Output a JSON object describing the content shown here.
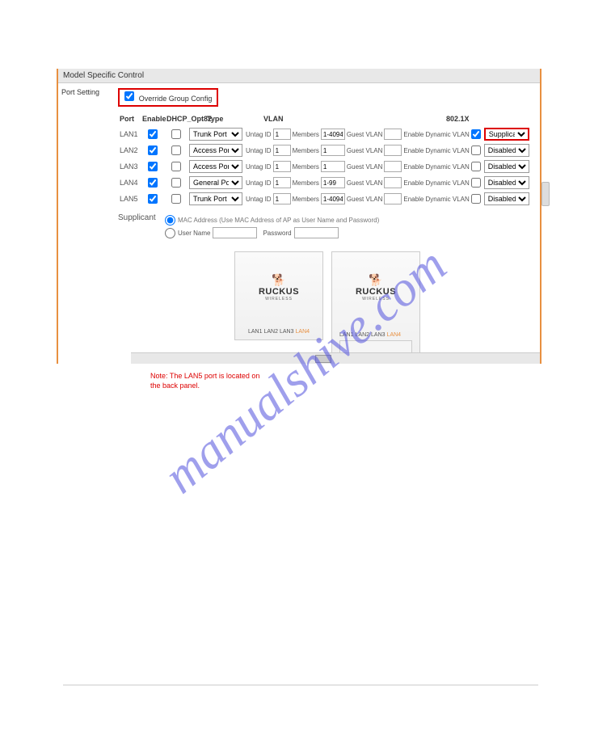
{
  "section_title": "Model Specific Control",
  "port_setting_label": "Port Setting",
  "override_label": "Override Group Config",
  "headers": {
    "port": "Port",
    "enable": "Enable",
    "dhcp": "DHCP_Opt82",
    "type": "Type",
    "vlan": "VLAN",
    "dot1x": "802.1X"
  },
  "rows": [
    {
      "port": "LAN1",
      "enable": true,
      "dhcp": false,
      "type": "Trunk Port",
      "untag_label": "Untag ID",
      "untag": "1",
      "members_label": "Members",
      "members": "1-4094",
      "guest_label": "Guest VLAN",
      "guest": "",
      "dyn_label": "Enable Dynamic VLAN",
      "dyn": true,
      "dot1x": "Supplicant",
      "dot1x_highlight": true
    },
    {
      "port": "LAN2",
      "enable": true,
      "dhcp": false,
      "type": "Access Port",
      "untag_label": "Untag ID",
      "untag": "1",
      "members_label": "Members",
      "members": "1",
      "guest_label": "Guest VLAN",
      "guest": "",
      "dyn_label": "Enable Dynamic VLAN",
      "dyn": false,
      "dot1x": "Disabled",
      "dot1x_highlight": false
    },
    {
      "port": "LAN3",
      "enable": true,
      "dhcp": false,
      "type": "Access Port",
      "untag_label": "Untag ID",
      "untag": "1",
      "members_label": "Members",
      "members": "1",
      "guest_label": "Guest VLAN",
      "guest": "",
      "dyn_label": "Enable Dynamic VLAN",
      "dyn": false,
      "dot1x": "Disabled",
      "dot1x_highlight": false
    },
    {
      "port": "LAN4",
      "enable": true,
      "dhcp": false,
      "type": "General Port",
      "untag_label": "Untag ID",
      "untag": "1",
      "members_label": "Members",
      "members": "1-99",
      "guest_label": "Guest VLAN",
      "guest": "",
      "dyn_label": "Enable Dynamic VLAN",
      "dyn": false,
      "dot1x": "Disabled",
      "dot1x_highlight": false
    },
    {
      "port": "LAN5",
      "enable": true,
      "dhcp": false,
      "type": "Trunk Port",
      "untag_label": "Untag ID",
      "untag": "1",
      "members_label": "Members",
      "members": "1-4094",
      "guest_label": "Guest VLAN",
      "guest": "",
      "dyn_label": "Enable Dynamic VLAN",
      "dyn": false,
      "dot1x": "Disabled",
      "dot1x_highlight": false
    }
  ],
  "supplicant": {
    "label": "Supplicant",
    "mac_option": "MAC Address (Use MAC Address of AP as User Name and Password)",
    "user_option": "User Name",
    "password_label": "Password"
  },
  "device_logo": "RUCKUS",
  "device_sub": "WIRELESS",
  "device1_lans": [
    "LAN1",
    "LAN2",
    "LAN3",
    "LAN4"
  ],
  "device2_lans": [
    "LAN1",
    "LAN2",
    "LAN3",
    "LAN4"
  ],
  "note": "Note: The LAN5 port is located on the back panel.",
  "watermark": "manualshive.com"
}
